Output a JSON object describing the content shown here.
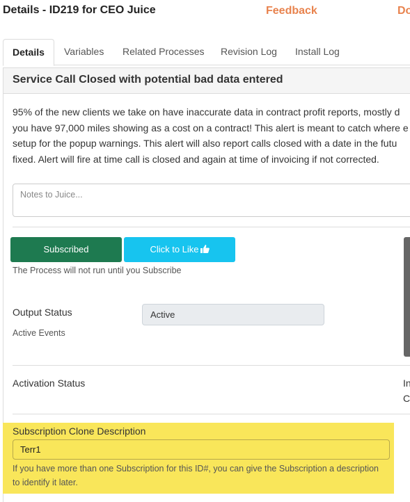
{
  "header": {
    "title": "Details - ID219 for CEO Juice",
    "feedback": "Feedback",
    "truncated_link": "Do"
  },
  "tabs": [
    {
      "label": "Details",
      "active": true
    },
    {
      "label": "Variables",
      "active": false
    },
    {
      "label": "Related Processes",
      "active": false
    },
    {
      "label": "Revision Log",
      "active": false
    },
    {
      "label": "Install Log",
      "active": false
    }
  ],
  "panel": {
    "title": "Service Call Closed with potential bad data entered",
    "description_lines": [
      "95% of the new clients we take on have inaccurate data in contract profit reports, mostly d",
      "you have 97,000 miles showing as a cost on a contract! This alert is meant to catch where e",
      "setup for the popup warnings. This alert will also report calls closed with a date in the futu",
      "fixed. Alert will fire at time call is closed and again at time of invoicing if not corrected."
    ],
    "notes_placeholder": "Notes to Juice..."
  },
  "actions": {
    "subscribed_label": "Subscribed",
    "like_label": "Click to Like",
    "like_icon": "thumbs-up-icon",
    "subscribe_note": "The Process will not run until you Subscribe"
  },
  "output": {
    "label": "Output Status",
    "sub_label": "Active Events",
    "value": "Active"
  },
  "activation": {
    "label": "Activation Status",
    "right_clip_1": "In",
    "right_clip_2": "C"
  },
  "clone": {
    "label": "Subscription Clone Description",
    "value": "Terr1",
    "help_line_1": "If you have more than one Subscription for this ID#, you can give the Subscription a description",
    "help_line_2": "to identify it later.",
    "highlight_color": "#f9e65a"
  },
  "colors": {
    "accent_orange": "#e8834e",
    "subscribed_green": "#1e7a50",
    "like_blue": "#17c4ef"
  }
}
